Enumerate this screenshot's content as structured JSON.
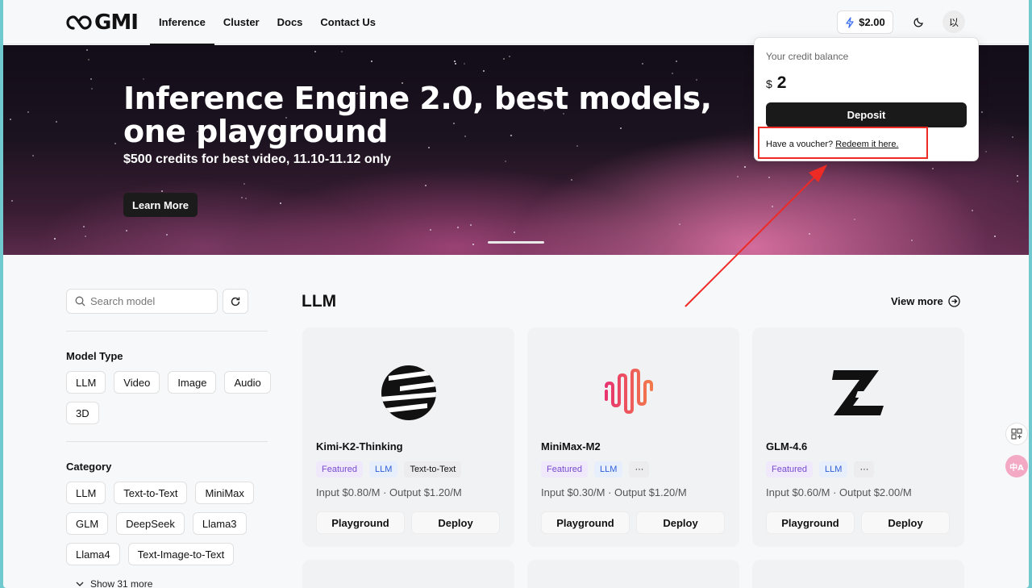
{
  "nav": {
    "logo_text": "GMI",
    "links": [
      "Inference",
      "Cluster",
      "Docs",
      "Contact Us"
    ],
    "active_index": 0,
    "credit_label": "$2.00",
    "user_initials": "以"
  },
  "hero": {
    "title": "Inference Engine 2.0, best models, one playground",
    "subtitle": "$500 credits for best video, 11.10-11.12 only",
    "cta": "Learn More"
  },
  "sidebar": {
    "search_placeholder": "Search model",
    "model_type_title": "Model Type",
    "model_types": [
      "LLM",
      "Video",
      "Image",
      "Audio",
      "3D"
    ],
    "category_title": "Category",
    "categories": [
      "LLM",
      "Text-to-Text",
      "MiniMax",
      "GLM",
      "DeepSeek",
      "Llama3",
      "Llama4",
      "Text-Image-to-Text"
    ],
    "show_more": "Show 31 more"
  },
  "content": {
    "section_title": "LLM",
    "view_more": "View more",
    "cards": [
      {
        "name": "Kimi-K2-Thinking",
        "tags": [
          "Featured",
          "LLM",
          "Text-to-Text"
        ],
        "price": "Input $0.80/M · Output $1.20/M",
        "logo": "kimi-logo"
      },
      {
        "name": "MiniMax-M2",
        "tags": [
          "Featured",
          "LLM",
          "···"
        ],
        "price": "Input $0.30/M · Output $1.20/M",
        "logo": "minimax-logo"
      },
      {
        "name": "GLM-4.6",
        "tags": [
          "Featured",
          "LLM",
          "···"
        ],
        "price": "Input $0.60/M · Output $2.00/M",
        "logo": "glm-logo"
      }
    ],
    "playground_label": "Playground",
    "deploy_label": "Deploy"
  },
  "credit_dropdown": {
    "title": "Your credit balance",
    "currency": "$",
    "amount": "2",
    "deposit": "Deposit",
    "voucher_text": "Have a voucher?",
    "voucher_link": "Redeem it here."
  },
  "colors": {
    "annotation_red": "#ee2a24",
    "featured_tag": "#7a4ad0",
    "llm_tag": "#2f5fd8"
  }
}
